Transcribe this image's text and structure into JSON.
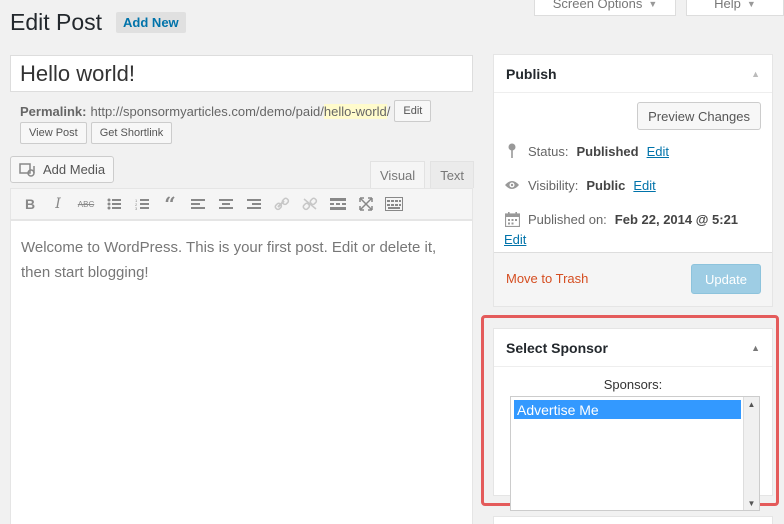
{
  "screen_options": {
    "screen_options_label": "Screen Options",
    "help_label": "Help"
  },
  "header": {
    "title": "Edit Post",
    "add_new": "Add New"
  },
  "post": {
    "title": "Hello world!",
    "permalink_label": "Permalink:",
    "permalink_base": "http://sponsormyarticles.com/demo/paid/",
    "permalink_slug": "hello-world",
    "permalink_trail": "/",
    "edit_label": "Edit",
    "view_post": "View Post",
    "get_shortlink": "Get Shortlink"
  },
  "editor": {
    "add_media": "Add Media",
    "tab_visual": "Visual",
    "tab_text": "Text",
    "toolbar_icons": [
      "bold-icon",
      "italic-icon",
      "strikethrough-icon",
      "bullet-list-icon",
      "numbered-list-icon",
      "blockquote-icon",
      "align-left-icon",
      "align-center-icon",
      "align-right-icon",
      "link-icon",
      "unlink-icon",
      "read-more-icon",
      "fullscreen-icon",
      "toolbar-toggle-icon"
    ],
    "content": "Welcome to WordPress. This is your first post. Edit or delete it, then start blogging!"
  },
  "publish": {
    "title": "Publish",
    "preview": "Preview Changes",
    "status_label": "Status:",
    "status_value": "Published",
    "visibility_label": "Visibility:",
    "visibility_value": "Public",
    "published_label": "Published on:",
    "published_value": "Feb 22, 2014 @ 5:21",
    "edit": "Edit",
    "trash": "Move to Trash",
    "update": "Update"
  },
  "sponsor": {
    "title": "Select Sponsor",
    "label": "Sponsors:",
    "options": [
      "Advertise Me"
    ],
    "highlight_color": "#e45b5b"
  }
}
